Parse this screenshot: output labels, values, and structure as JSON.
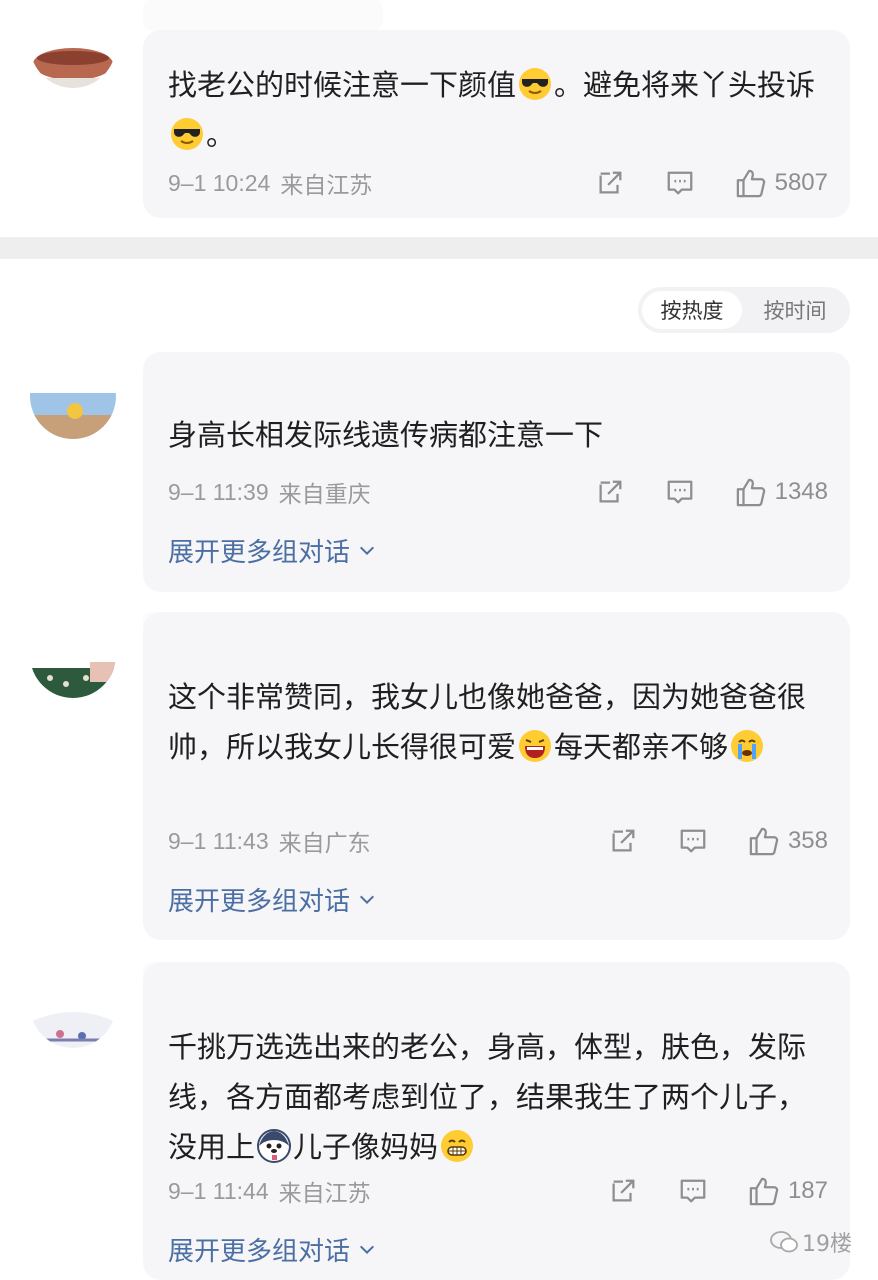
{
  "sort": {
    "hot": "按热度",
    "time": "按时间"
  },
  "comments": [
    {
      "text_parts": [
        "找老公的时候注意一下颜值",
        "。避免将来丫头投诉",
        "。"
      ],
      "time": "9–1 10:24",
      "location": "来自江苏",
      "likes": "5807",
      "emojis": [
        "sunglasses-emoji",
        "sunglasses-emoji"
      ]
    },
    {
      "text": "身高长相发际线遗传病都注意一下",
      "time": "9–1 11:39",
      "location": "来自重庆",
      "likes": "1348",
      "expand": "展开更多组对话"
    },
    {
      "text_parts": [
        "这个非常赞同，我女儿也像她爸爸，因为她爸爸很帅，所以我女儿长得很可爱",
        "每天都亲不够",
        ""
      ],
      "time": "9–1 11:43",
      "location": "来自广东",
      "likes": "358",
      "expand": "展开更多组对话",
      "emojis": [
        "laughing-tears-emoji",
        "crying-emoji"
      ]
    },
    {
      "text_parts": [
        "千挑万选选出来的老公，身高，体型，肤色，发际线，各方面都考虑到位了，结果我生了两个儿子，没用上",
        "儿子像妈妈",
        ""
      ],
      "time": "9–1 11:44",
      "location": "来自江苏",
      "likes": "187",
      "expand": "展开更多组对话",
      "emojis": [
        "husky-emoji",
        "grin-emoji"
      ]
    }
  ],
  "watermark": "19楼",
  "icons": [
    "share-icon",
    "comment-icon",
    "like-icon",
    "chevron-down-icon",
    "wechat-icon"
  ],
  "colors": {
    "link": "#4c6fa3",
    "meta": "#9a9a9a",
    "card": "#f6f6f8"
  }
}
